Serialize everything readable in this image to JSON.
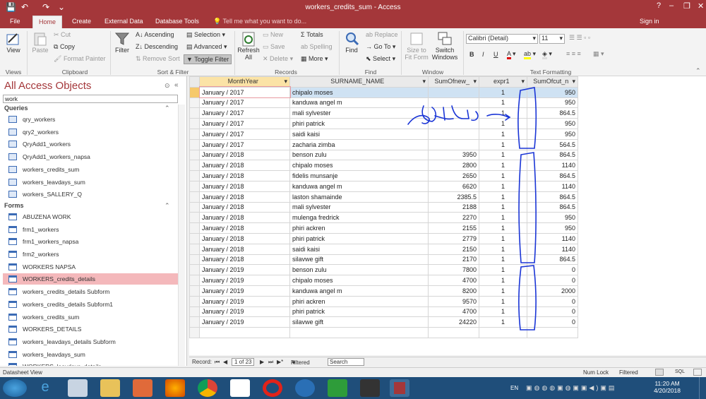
{
  "window": {
    "title": "workers_credits_sum - Access",
    "help": "?",
    "minimize": "–",
    "restore": "❐",
    "close": "✕"
  },
  "quick_access": {
    "save": "💾",
    "undo": "↶",
    "redo": "↷",
    "customize": "⌄"
  },
  "tabs": [
    "File",
    "Home",
    "Create",
    "External Data",
    "Database Tools"
  ],
  "tell_me": "Tell me what you want to do...",
  "sign_in": "Sign in",
  "ribbon": {
    "views": {
      "view": "View",
      "label": "Views"
    },
    "clipboard": {
      "paste": "Paste",
      "cut": "Cut",
      "copy": "Copy",
      "format_painter": "Format Painter",
      "label": "Clipboard"
    },
    "sort_filter": {
      "filter": "Filter",
      "ascending": "Ascending",
      "descending": "Descending",
      "remove_sort": "Remove Sort",
      "selection": "Selection",
      "advanced": "Advanced",
      "toggle_filter": "Toggle Filter",
      "label": "Sort & Filter"
    },
    "records": {
      "refresh": "Refresh",
      "refresh2": "All",
      "new": "New",
      "save": "Save",
      "delete": "Delete",
      "totals": "Totals",
      "spelling": "Spelling",
      "more": "More",
      "label": "Records"
    },
    "find": {
      "find": "Find",
      "replace": "Replace",
      "goto": "Go To",
      "select": "Select",
      "label": "Find"
    },
    "window": {
      "size_to_fit": "Size to",
      "size_to_fit2": "Fit Form",
      "switch": "Switch",
      "switch2": "Windows",
      "label": "Window"
    },
    "text_formatting": {
      "font": "Calibri (Detail)",
      "size": "11",
      "bold": "B",
      "italic": "I",
      "underline": "U",
      "label": "Text Formatting"
    }
  },
  "navpane": {
    "header": "All Access Objects",
    "search": "work",
    "queries_label": "Queries",
    "queries": [
      "qry_workers",
      "qry2_workers",
      "QryAdd1_workers",
      "QryAdd1_workers_napsa",
      "workers_credits_sum",
      "workers_leavdays_sum",
      "workers_SALLERY_Q"
    ],
    "forms_label": "Forms",
    "forms": [
      "ABUZENA WORK",
      "frm1_workers",
      "frm1_workers_napsa",
      "frm2_workers",
      "WORKERS NAPSA",
      "WORKERS_credits_details",
      "workers_credits_details Subform",
      "workers_credits_details Subform1",
      "workers_credits_sum",
      "WORKERS_DETAILS",
      "workers_leavdays_details Subform",
      "workers_leavdays_sum",
      "WORKERS_leavdays_details"
    ]
  },
  "grid": {
    "columns": [
      "MonthYear",
      "SURNAME_NAME",
      "SumOfnew_",
      "expr1",
      "SumOfcut_n"
    ],
    "rows": [
      [
        "January / 2017",
        "chipalo moses",
        "",
        "1",
        "950"
      ],
      [
        "January / 2017",
        "kanduwa angel m",
        "",
        "1",
        "950"
      ],
      [
        "January / 2017",
        "mali sylvester",
        "",
        "1",
        "864.5"
      ],
      [
        "January / 2017",
        "phiri patrick",
        "",
        "1",
        "950"
      ],
      [
        "January / 2017",
        "saidi kaisi",
        "",
        "1",
        "950"
      ],
      [
        "January / 2017",
        "zacharia zimba",
        "",
        "1",
        "564.5"
      ],
      [
        "January / 2018",
        "benson zulu",
        "3950",
        "1",
        "864.5"
      ],
      [
        "January / 2018",
        "chipalo moses",
        "2800",
        "1",
        "1140"
      ],
      [
        "January / 2018",
        "fidelis munsanje",
        "2650",
        "1",
        "864.5"
      ],
      [
        "January / 2018",
        "kanduwa angel m",
        "6620",
        "1",
        "1140"
      ],
      [
        "January / 2018",
        "laston shamainde",
        "2385.5",
        "1",
        "864.5"
      ],
      [
        "January / 2018",
        "mali sylvester",
        "2188",
        "1",
        "864.5"
      ],
      [
        "January / 2018",
        "mulenga fredrick",
        "2270",
        "1",
        "950"
      ],
      [
        "January / 2018",
        "phiri ackren",
        "2155",
        "1",
        "950"
      ],
      [
        "January / 2018",
        "phiri patrick",
        "2779",
        "1",
        "1140"
      ],
      [
        "January / 2018",
        "saidi kaisi",
        "2150",
        "1",
        "1140"
      ],
      [
        "January / 2018",
        "silavwe gift",
        "2170",
        "1",
        "864.5"
      ],
      [
        "January / 2019",
        "benson zulu",
        "7800",
        "1",
        "0"
      ],
      [
        "January / 2019",
        "chipalo moses",
        "4700",
        "1",
        "0"
      ],
      [
        "January / 2019",
        "kanduwa angel m",
        "8200",
        "1",
        "2000"
      ],
      [
        "January / 2019",
        "phiri ackren",
        "9570",
        "1",
        "0"
      ],
      [
        "January / 2019",
        "phiri patrick",
        "4700",
        "1",
        "0"
      ],
      [
        "January / 2019",
        "silavwe gift",
        "24220",
        "1",
        "0"
      ]
    ]
  },
  "recordbar": {
    "label": "Record:",
    "first": "⏮",
    "prev": "◀",
    "position": "1 of 23",
    "next": "▶",
    "last": "⏭",
    "new": "▶*",
    "filtered": "Filtered",
    "search": "Search"
  },
  "status": {
    "view": "Datasheet View",
    "numlock": "Num Lock",
    "filtered": "Filtered"
  },
  "taskbar": {
    "lang": "EN",
    "time": "11:20 AM",
    "date": "4/20/2018"
  },
  "colors": {
    "accent": "#a4373a",
    "selected_row": "#cfe2f3",
    "annotation": "#1a35d6"
  }
}
